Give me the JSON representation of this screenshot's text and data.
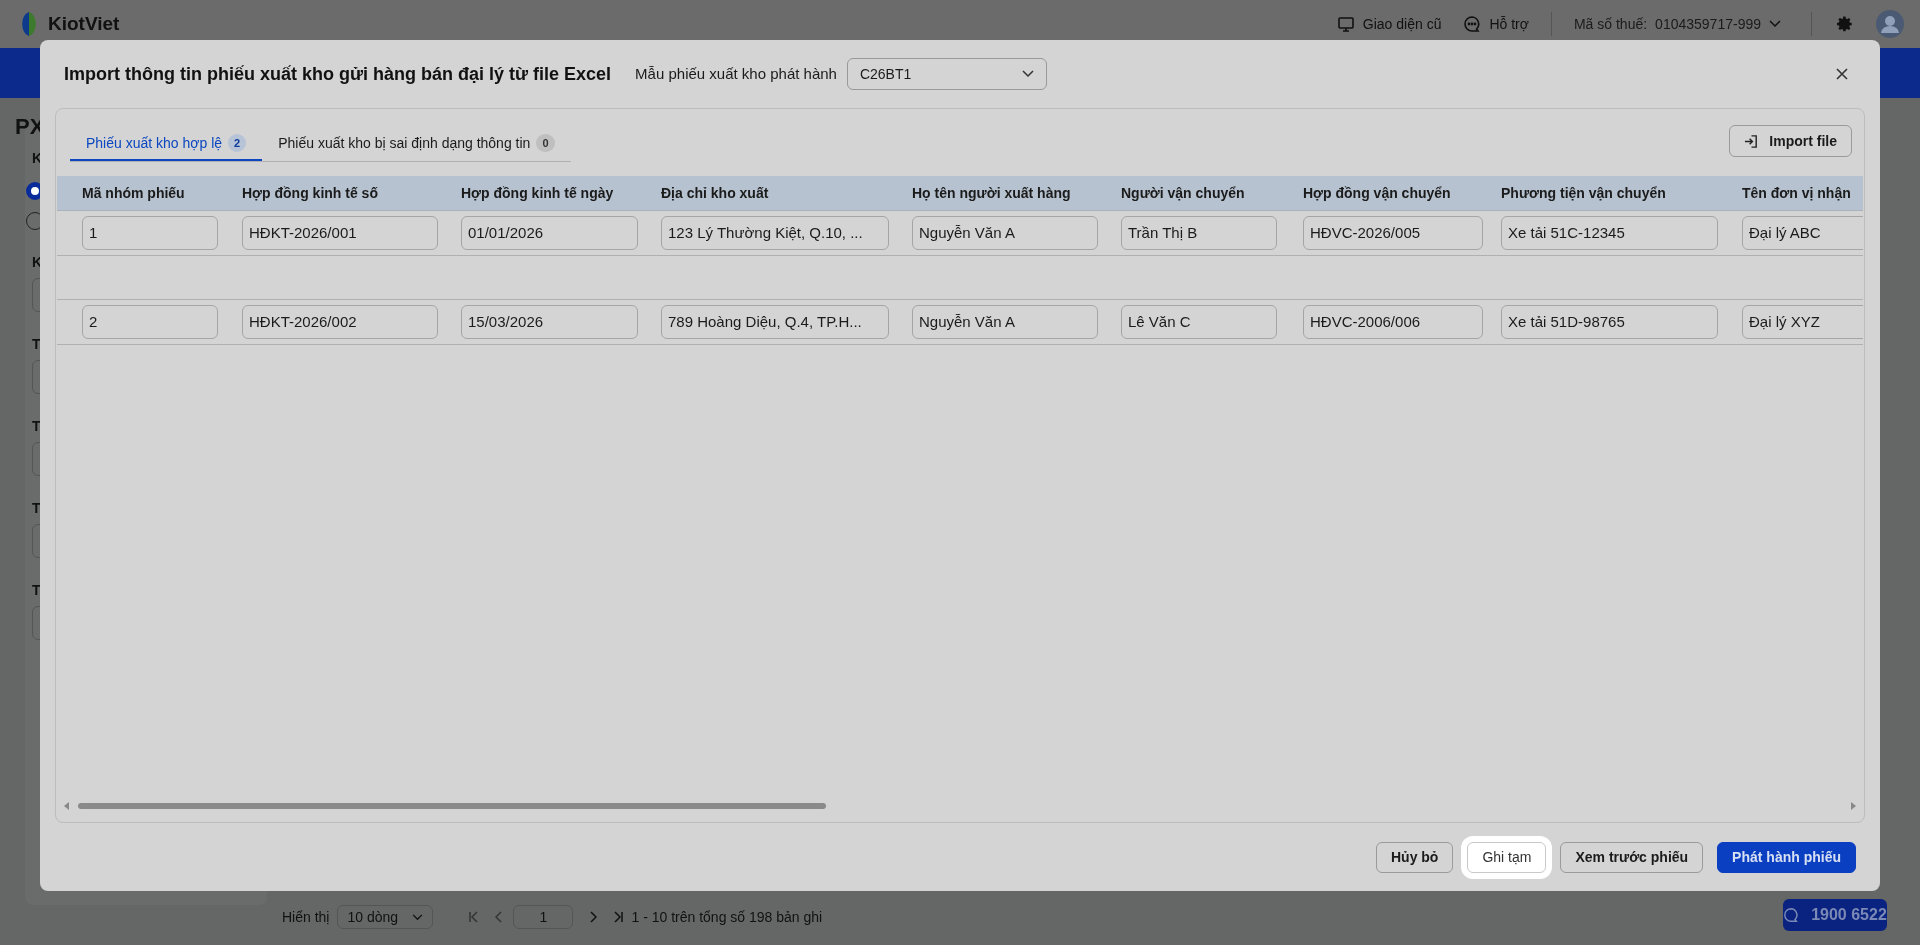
{
  "topbar": {
    "logo": "KiotViet",
    "links": [
      {
        "label": "Giao diện cũ",
        "kind": "monitor"
      },
      {
        "label": "Hỗ trợ",
        "kind": "chat"
      }
    ],
    "tax_label": "Mã số thuế:",
    "tax_value": "0104359717-999"
  },
  "background_page": {
    "title": "PX",
    "radios": [
      {
        "selected": true
      },
      {
        "selected": false
      }
    ],
    "labels": [
      "K",
      "K",
      "T",
      "T",
      "T",
      "T"
    ]
  },
  "dialog": {
    "title": "Import thông tin phiếu xuất kho gửi hàng bán đại lý từ file Excel",
    "template_label": "Mẫu phiếu xuất kho phát hành",
    "template_value": "C26BT1",
    "tabs": [
      {
        "label": "Phiếu xuất kho hợp lệ",
        "count": "2",
        "selected": true
      },
      {
        "label": "Phiếu xuất kho bị sai định dạng thông tin",
        "count": "0",
        "selected": false
      }
    ],
    "import_button": "Import file",
    "table": {
      "columns": [
        "Mã nhóm phiếu",
        "Hợp đồng kinh tế số",
        "Hợp đồng kinh tế ngày",
        "Địa chỉ kho xuất",
        "Họ tên người xuất hàng",
        "Người vận chuyển",
        "Hợp đồng vận chuyển",
        "Phương tiện vận chuyển",
        "Tên đơn vị nhận"
      ],
      "rows": [
        {
          "kind": "data",
          "cells": [
            "1",
            "HĐKT-2026/001",
            "01/01/2026",
            "123 Lý Thường Kiệt, Q.10, ...",
            "Nguyễn Văn A",
            "Trần Thị B",
            "HĐVC-2026/005",
            "Xe tải 51C-12345",
            "Đại lý ABC"
          ]
        },
        {
          "kind": "empty"
        },
        {
          "kind": "data",
          "cells": [
            "2",
            "HĐKT-2026/002",
            "15/03/2026",
            "789 Hoàng Diệu, Q.4, TP.H...",
            "Nguyễn Văn A",
            "Lê Văn C",
            "HĐVC-2006/006",
            "Xe tải 51D-98765",
            "Đại lý XYZ"
          ]
        }
      ]
    },
    "buttons": [
      {
        "label": "Hủy bỏ",
        "kind": "default"
      },
      {
        "label": "Ghi tạm",
        "kind": "highlighted"
      },
      {
        "label": "Xem trước phiếu",
        "kind": "default"
      },
      {
        "label": "Phát hành phiếu",
        "kind": "primary"
      }
    ]
  },
  "pagination": {
    "show_label": "Hiển thị",
    "page_size": "10 dòng",
    "page": "1",
    "summary": "1 - 10 trên tổng số 198 bản ghi"
  },
  "hotline": "1900 6522"
}
